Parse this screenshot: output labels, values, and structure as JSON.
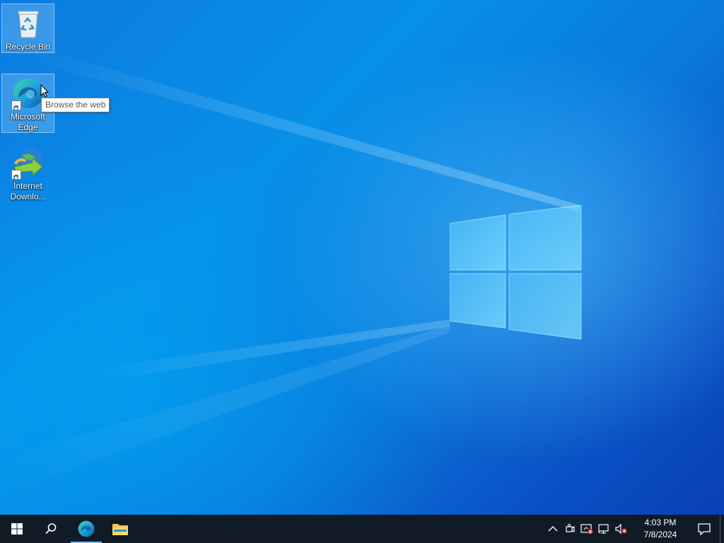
{
  "desktop": {
    "icons": [
      {
        "label": "Recycle Bin",
        "icon": "recycle-bin-icon"
      },
      {
        "label": "Microsoft Edge",
        "icon": "edge-icon"
      },
      {
        "label": "Internet Downlo...",
        "icon": "internet-download-manager-icon"
      }
    ],
    "tooltip": "Browse the web"
  },
  "taskbar": {
    "start": "start-icon",
    "search": "search-icon",
    "pinned": [
      {
        "name": "Microsoft Edge",
        "icon": "edge-icon"
      },
      {
        "name": "File Explorer",
        "icon": "folder-icon"
      }
    ],
    "tray": {
      "icons": [
        "chevron-up-icon",
        "meet-now-icon",
        "security-icon",
        "network-icon",
        "volume-muted-icon"
      ],
      "time": "4:03 PM",
      "date": "7/8/2024",
      "notification_icon": "action-center-icon"
    }
  },
  "colors": {
    "accent": "#0078d7",
    "taskbar": "#101b26"
  }
}
